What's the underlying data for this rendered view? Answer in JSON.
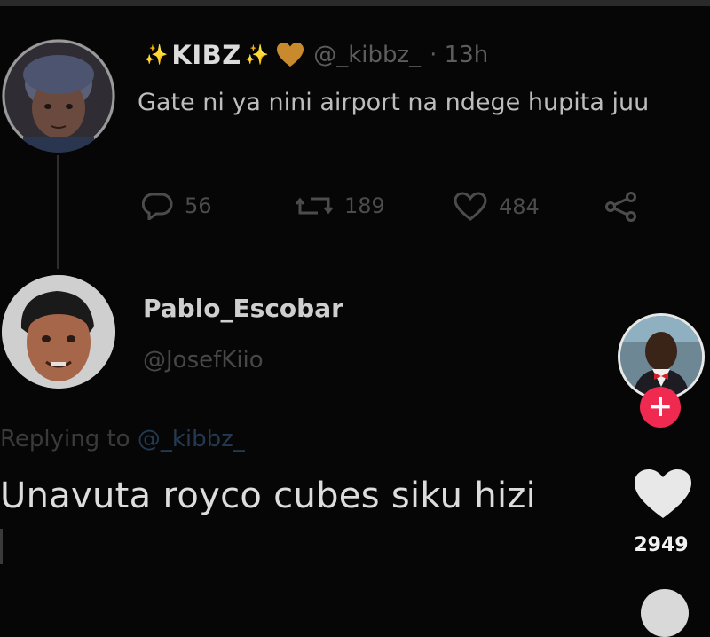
{
  "tweet": {
    "display_name": "KIBZ",
    "sparkle_left": "✨",
    "sparkle_right": "✨",
    "handle": "@_kibbz_",
    "time": "· 13h",
    "text": "Gate ni ya nini airport na ndege hupita juu",
    "stats": {
      "replies": "56",
      "retweets": "189",
      "likes": "484"
    },
    "icons": {
      "badge": "orange-heart-icon",
      "reply": "comment-icon",
      "retweet": "retweet-icon",
      "like": "heart-outline-icon",
      "share": "share-icon"
    },
    "colors": {
      "badge": "#c98a2e"
    }
  },
  "reply": {
    "display_name": "Pablo_Escobar",
    "handle": "@JosefKiio",
    "replying_prefix": "Replying to",
    "replying_to": "@_kibbz_",
    "text": "Unavuta royco cubes siku hizi"
  },
  "sidebar": {
    "like_count": "2949",
    "follow_symbol": "+",
    "icons": {
      "like": "heart-icon",
      "follow": "plus-icon",
      "profile": "creator-avatar"
    },
    "colors": {
      "follow": "#ef2950",
      "like": "#e8e8e8"
    }
  }
}
